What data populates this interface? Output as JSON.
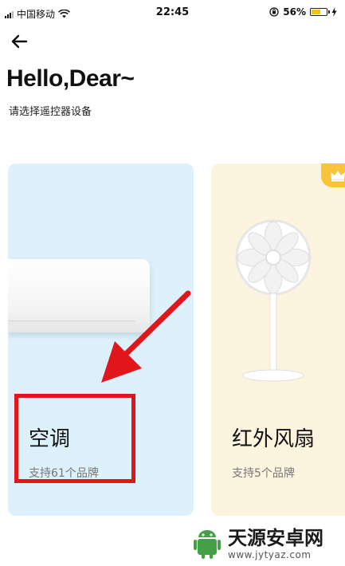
{
  "status_bar": {
    "carrier": "中国移动",
    "time": "22:45",
    "battery": "56%"
  },
  "header": {
    "title": "Hello,Dear~",
    "subtitle": "请选择遥控器设备"
  },
  "cards": [
    {
      "title": "空调",
      "desc": "支持61个品牌"
    },
    {
      "title": "红外风扇",
      "desc": "支持5个品牌"
    }
  ],
  "colors": {
    "ac_card_bg": "#dcf1fb",
    "fan_card_bg": "#fdf4df",
    "annotation_red": "#e0161b",
    "crown_gold": "#f7c43a"
  },
  "icons": [
    "back-arrow-icon",
    "wifi-icon",
    "orientation-lock-icon",
    "battery-icon",
    "charging-icon",
    "crown-icon"
  ],
  "watermark": {
    "name": "天源安卓网",
    "url": "www.jytyaz.com"
  }
}
